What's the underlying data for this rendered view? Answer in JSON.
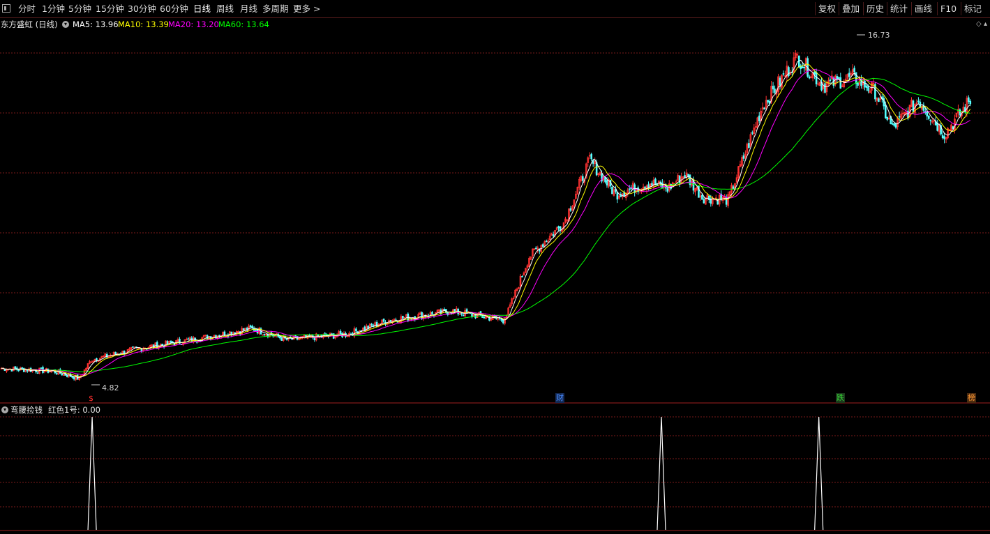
{
  "toolbar": {
    "periods": [
      "分时",
      "1分钟",
      "5分钟",
      "15分钟",
      "30分钟",
      "60分钟",
      "日线",
      "周线",
      "月线",
      "多周期",
      "更多 >"
    ],
    "active_period": "日线",
    "right_buttons": [
      "复权",
      "叠加",
      "历史",
      "统计",
      "画线",
      "F10",
      "标记"
    ]
  },
  "main_chart": {
    "title": "东方盛虹 (日线)",
    "ma_labels": [
      {
        "text": "MA5: 13.96",
        "color": "#ffffff"
      },
      {
        "text": "MA10: 13.39",
        "color": "#ffff00"
      },
      {
        "text": "MA20: 13.20",
        "color": "#ff00ff"
      },
      {
        "text": "MA60: 13.64",
        "color": "#00ff00"
      }
    ],
    "high_label": "16.73",
    "low_label": "4.82",
    "event_markers": [
      {
        "text": "$",
        "color": "#ff3030"
      },
      {
        "text": "财",
        "color": "#4a8cff"
      },
      {
        "text": "跌",
        "color": "#33cc33"
      },
      {
        "text": "榜",
        "color": "#ff9933"
      }
    ]
  },
  "indicator": {
    "name": "弯腰捡钱",
    "value_label": "红色1号: 0.00"
  },
  "colors": {
    "up_candle": "#ff3232",
    "down_candle": "#54ffff",
    "grid": "#7a1a1a",
    "ma5": "#ffffff",
    "ma10": "#ffff00",
    "ma20": "#ff00ff",
    "ma60": "#00ff00"
  },
  "chart_data": {
    "type": "candlestick",
    "price_range": [
      4.82,
      16.73
    ],
    "key_points": [
      {
        "t": 0,
        "p": 5.3
      },
      {
        "t": 30,
        "p": 5.2
      },
      {
        "t": 45,
        "p": 4.95
      },
      {
        "t": 52,
        "p": 5.6
      },
      {
        "t": 80,
        "p": 6.0
      },
      {
        "t": 110,
        "p": 6.3
      },
      {
        "t": 145,
        "p": 6.7
      },
      {
        "t": 165,
        "p": 6.3
      },
      {
        "t": 200,
        "p": 6.5
      },
      {
        "t": 225,
        "p": 7.0
      },
      {
        "t": 260,
        "p": 7.3
      },
      {
        "t": 290,
        "p": 7.0
      },
      {
        "t": 293,
        "p": 7.3
      },
      {
        "t": 305,
        "p": 9.2
      },
      {
        "t": 325,
        "p": 10.4
      },
      {
        "t": 340,
        "p": 12.6
      },
      {
        "t": 355,
        "p": 11.4
      },
      {
        "t": 375,
        "p": 11.8
      },
      {
        "t": 385,
        "p": 11.6
      },
      {
        "t": 395,
        "p": 12.1
      },
      {
        "t": 405,
        "p": 11.3
      },
      {
        "t": 420,
        "p": 11.2
      },
      {
        "t": 440,
        "p": 14.5
      },
      {
        "t": 460,
        "p": 16.2
      },
      {
        "t": 475,
        "p": 15.2
      },
      {
        "t": 492,
        "p": 15.5
      },
      {
        "t": 505,
        "p": 15.0
      },
      {
        "t": 515,
        "p": 13.7
      },
      {
        "t": 530,
        "p": 14.7
      },
      {
        "t": 545,
        "p": 13.5
      },
      {
        "t": 560,
        "p": 14.7
      }
    ],
    "signal_spikes_t": [
      46,
      375,
      466
    ]
  }
}
